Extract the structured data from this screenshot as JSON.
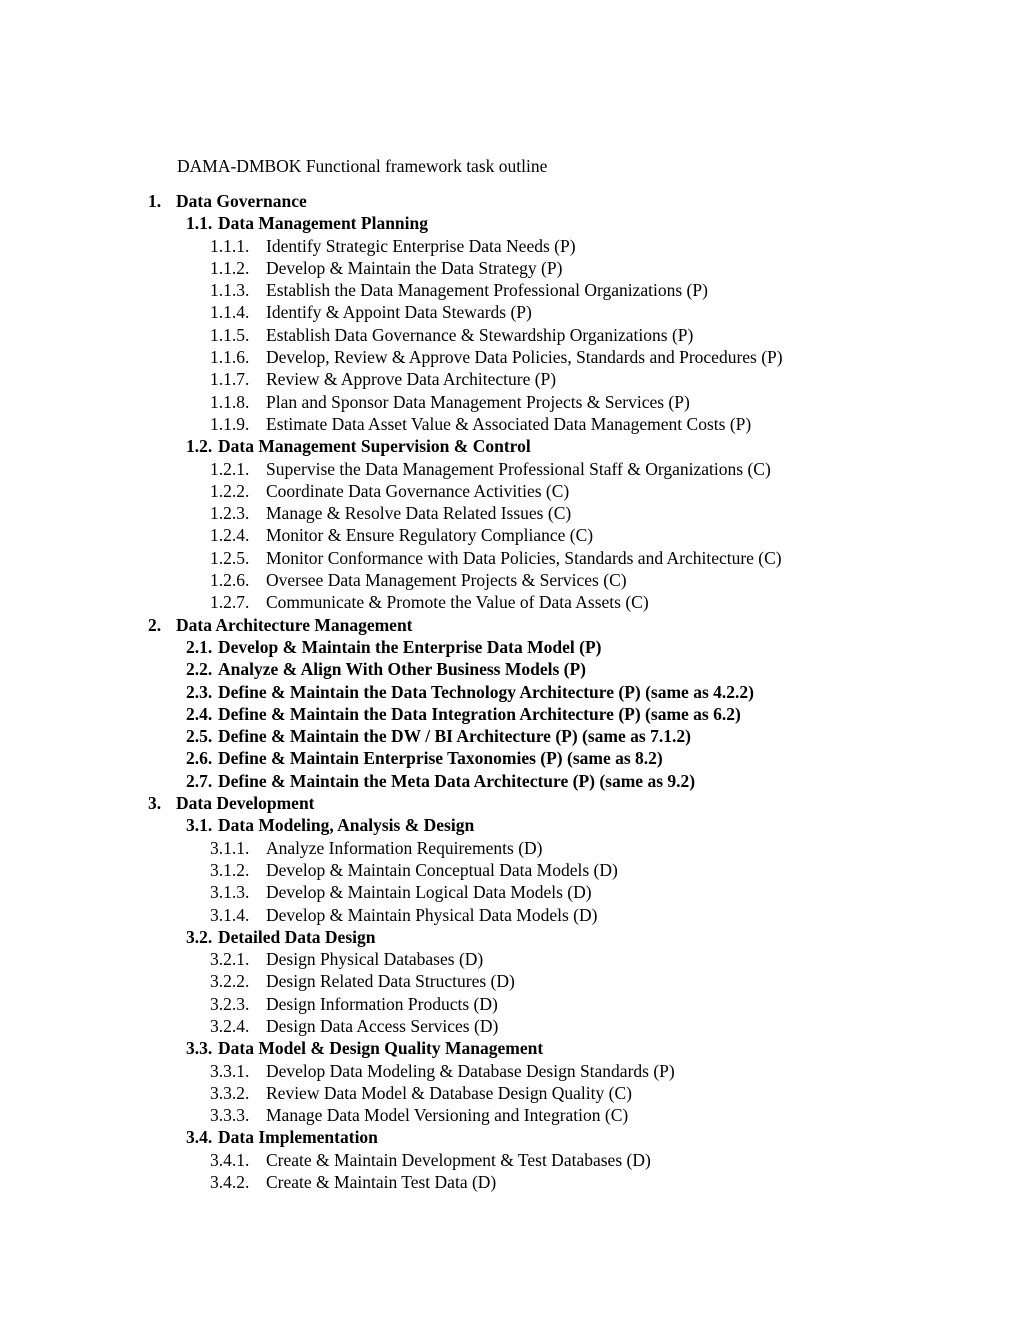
{
  "document": {
    "title": "DAMA-DMBOK Functional framework task outline",
    "page_background": "#ffffff",
    "text_color": "#000000"
  },
  "outline": [
    {
      "level": 1,
      "number": "1.",
      "text": "Data Governance"
    },
    {
      "level": 2,
      "number": "1.1.",
      "text": "Data Management Planning"
    },
    {
      "level": 3,
      "number": "1.1.1.",
      "text": "Identify Strategic Enterprise Data Needs (P)"
    },
    {
      "level": 3,
      "number": "1.1.2.",
      "text": "Develop & Maintain the Data Strategy (P)"
    },
    {
      "level": 3,
      "number": "1.1.3.",
      "text": "Establish the Data Management Professional Organizations (P)"
    },
    {
      "level": 3,
      "number": "1.1.4.",
      "text": "Identify & Appoint Data Stewards (P)"
    },
    {
      "level": 3,
      "number": "1.1.5.",
      "text": "Establish Data Governance & Stewardship Organizations (P)"
    },
    {
      "level": 3,
      "number": "1.1.6.",
      "text": "Develop, Review & Approve Data Policies, Standards and Procedures (P)"
    },
    {
      "level": 3,
      "number": "1.1.7.",
      "text": "Review & Approve Data Architecture (P)"
    },
    {
      "level": 3,
      "number": "1.1.8.",
      "text": "Plan and Sponsor Data Management Projects & Services (P)"
    },
    {
      "level": 3,
      "number": "1.1.9.",
      "text": "Estimate Data Asset Value & Associated Data Management Costs (P)"
    },
    {
      "level": 2,
      "number": "1.2.",
      "text": "Data Management Supervision & Control"
    },
    {
      "level": 3,
      "number": "1.2.1.",
      "text": "Supervise the Data Management Professional Staff & Organizations (C)"
    },
    {
      "level": 3,
      "number": "1.2.2.",
      "text": "Coordinate Data Governance Activities (C)"
    },
    {
      "level": 3,
      "number": "1.2.3.",
      "text": "Manage & Resolve Data Related Issues (C)"
    },
    {
      "level": 3,
      "number": "1.2.4.",
      "text": "Monitor & Ensure Regulatory Compliance (C)"
    },
    {
      "level": 3,
      "number": "1.2.5.",
      "text": "Monitor Conformance with Data Policies, Standards and Architecture (C)"
    },
    {
      "level": 3,
      "number": "1.2.6.",
      "text": "Oversee Data Management Projects & Services (C)"
    },
    {
      "level": 3,
      "number": "1.2.7.",
      "text": "Communicate & Promote the Value of Data Assets (C)"
    },
    {
      "level": 1,
      "number": "2.",
      "text": "Data Architecture Management"
    },
    {
      "level": 2,
      "number": "2.1.",
      "text": "Develop & Maintain the Enterprise Data Model (P)"
    },
    {
      "level": 2,
      "number": "2.2.",
      "text": "Analyze & Align With Other Business Models (P)"
    },
    {
      "level": 2,
      "number": "2.3.",
      "text": "Define & Maintain the Data Technology Architecture (P) (same as 4.2.2)"
    },
    {
      "level": 2,
      "number": "2.4.",
      "text": "Define & Maintain the Data Integration Architecture (P) (same as 6.2)"
    },
    {
      "level": 2,
      "number": "2.5.",
      "text": "Define & Maintain the DW / BI Architecture (P) (same as 7.1.2)"
    },
    {
      "level": 2,
      "number": "2.6.",
      "text": "Define & Maintain Enterprise Taxonomies (P) (same as 8.2)"
    },
    {
      "level": 2,
      "number": "2.7.",
      "text": "Define & Maintain the Meta Data Architecture (P) (same as 9.2)"
    },
    {
      "level": 1,
      "number": "3.",
      "text": "Data Development"
    },
    {
      "level": 2,
      "number": "3.1.",
      "text": "Data Modeling, Analysis & Design"
    },
    {
      "level": 3,
      "number": "3.1.1.",
      "text": "Analyze Information Requirements (D)"
    },
    {
      "level": 3,
      "number": "3.1.2.",
      "text": "Develop & Maintain Conceptual Data Models (D)"
    },
    {
      "level": 3,
      "number": "3.1.3.",
      "text": "Develop & Maintain Logical Data Models (D)"
    },
    {
      "level": 3,
      "number": "3.1.4.",
      "text": "Develop & Maintain Physical Data Models (D)"
    },
    {
      "level": 2,
      "number": "3.2.",
      "text": "Detailed Data Design"
    },
    {
      "level": 3,
      "number": "3.2.1.",
      "text": "Design Physical Databases (D)"
    },
    {
      "level": 3,
      "number": "3.2.2.",
      "text": "Design Related Data Structures (D)"
    },
    {
      "level": 3,
      "number": "3.2.3.",
      "text": "Design Information Products (D)"
    },
    {
      "level": 3,
      "number": "3.2.4.",
      "text": "Design Data Access Services (D)"
    },
    {
      "level": 2,
      "number": "3.3.",
      "text": "Data Model & Design Quality Management"
    },
    {
      "level": 3,
      "number": "3.3.1.",
      "text": "Develop Data Modeling & Database Design Standards (P)"
    },
    {
      "level": 3,
      "number": "3.3.2.",
      "text": "Review Data Model & Database Design Quality (C)"
    },
    {
      "level": 3,
      "number": "3.3.3.",
      "text": "Manage Data Model Versioning and Integration (C)"
    },
    {
      "level": 2,
      "number": "3.4.",
      "text": "Data Implementation"
    },
    {
      "level": 3,
      "number": "3.4.1.",
      "text": "Create & Maintain Development & Test Databases (D)"
    },
    {
      "level": 3,
      "number": "3.4.2.",
      "text": "Create & Maintain Test Data (D)"
    }
  ]
}
